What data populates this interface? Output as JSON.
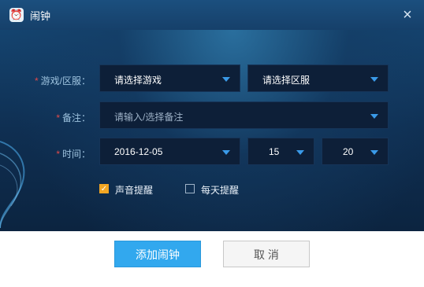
{
  "window": {
    "title": "闹钟",
    "close_glyph": "×",
    "icon": "alarm-clock-icon"
  },
  "form": {
    "game_server": {
      "required_mark": "*",
      "label": "游戏/区服：",
      "game_value": "请选择游戏",
      "server_value": "请选择区服"
    },
    "note": {
      "required_mark": "*",
      "label": "备注：",
      "placeholder": "请输入/选择备注"
    },
    "time": {
      "required_mark": "*",
      "label": "时间：",
      "date": "2016-12-05",
      "hour": "15",
      "minute": "20"
    },
    "sound_reminder": {
      "label": "声音提醒",
      "checked": true
    },
    "daily_reminder": {
      "label": "每天提醒",
      "checked": false
    }
  },
  "footer": {
    "add_label": "添加闹钟",
    "cancel_label": "取 消"
  },
  "colors": {
    "accent": "#32a8ee",
    "checkbox_checked": "#f2a623",
    "required": "#e24a4a"
  }
}
